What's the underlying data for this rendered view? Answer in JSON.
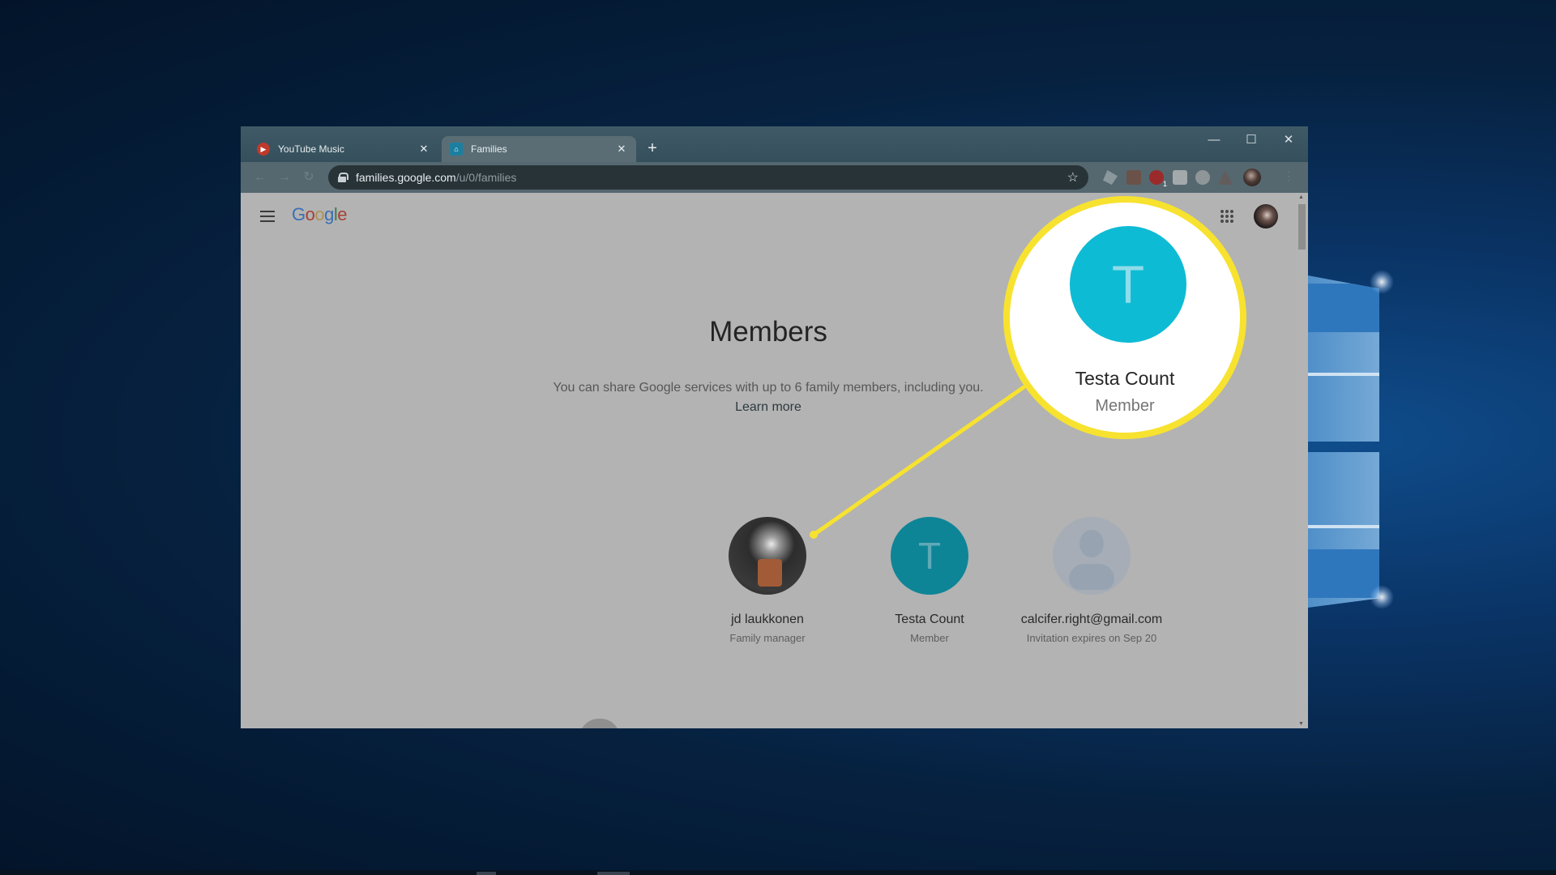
{
  "browser": {
    "tabs": [
      {
        "title": "YouTube Music",
        "favicon": "youtube-music-icon",
        "active": false
      },
      {
        "title": "Families",
        "favicon": "google-families-icon",
        "active": true
      }
    ],
    "new_tab_label": "+",
    "window_controls": {
      "minimize": "—",
      "maximize": "☐",
      "close": "✕"
    },
    "address": {
      "host": "families.google.com",
      "path": "/u/0/families"
    },
    "extension_badge": "1"
  },
  "page": {
    "logo": [
      "G",
      "o",
      "o",
      "g",
      "l",
      "e"
    ],
    "heading": "Members",
    "subtitle": "You can share Google services with up to 6 family members, including you.",
    "learn_more": "Learn more",
    "members": [
      {
        "name": "jd laukkonen",
        "role": "Family manager",
        "avatar": "photo"
      },
      {
        "name": "Testa Count",
        "role": "Member",
        "avatar": "initial",
        "initial": "T"
      },
      {
        "name": "calcifer.right@gmail.com",
        "role": "Invitation expires on Sep 20",
        "avatar": "placeholder"
      }
    ]
  },
  "callout": {
    "initial": "T",
    "name": "Testa Count",
    "role": "Member",
    "color": "#f7e22f"
  },
  "colors": {
    "accent_teal": "#0e8597",
    "callout_avatar": "#0ebbd4",
    "highlight_yellow": "#f7e22f"
  }
}
